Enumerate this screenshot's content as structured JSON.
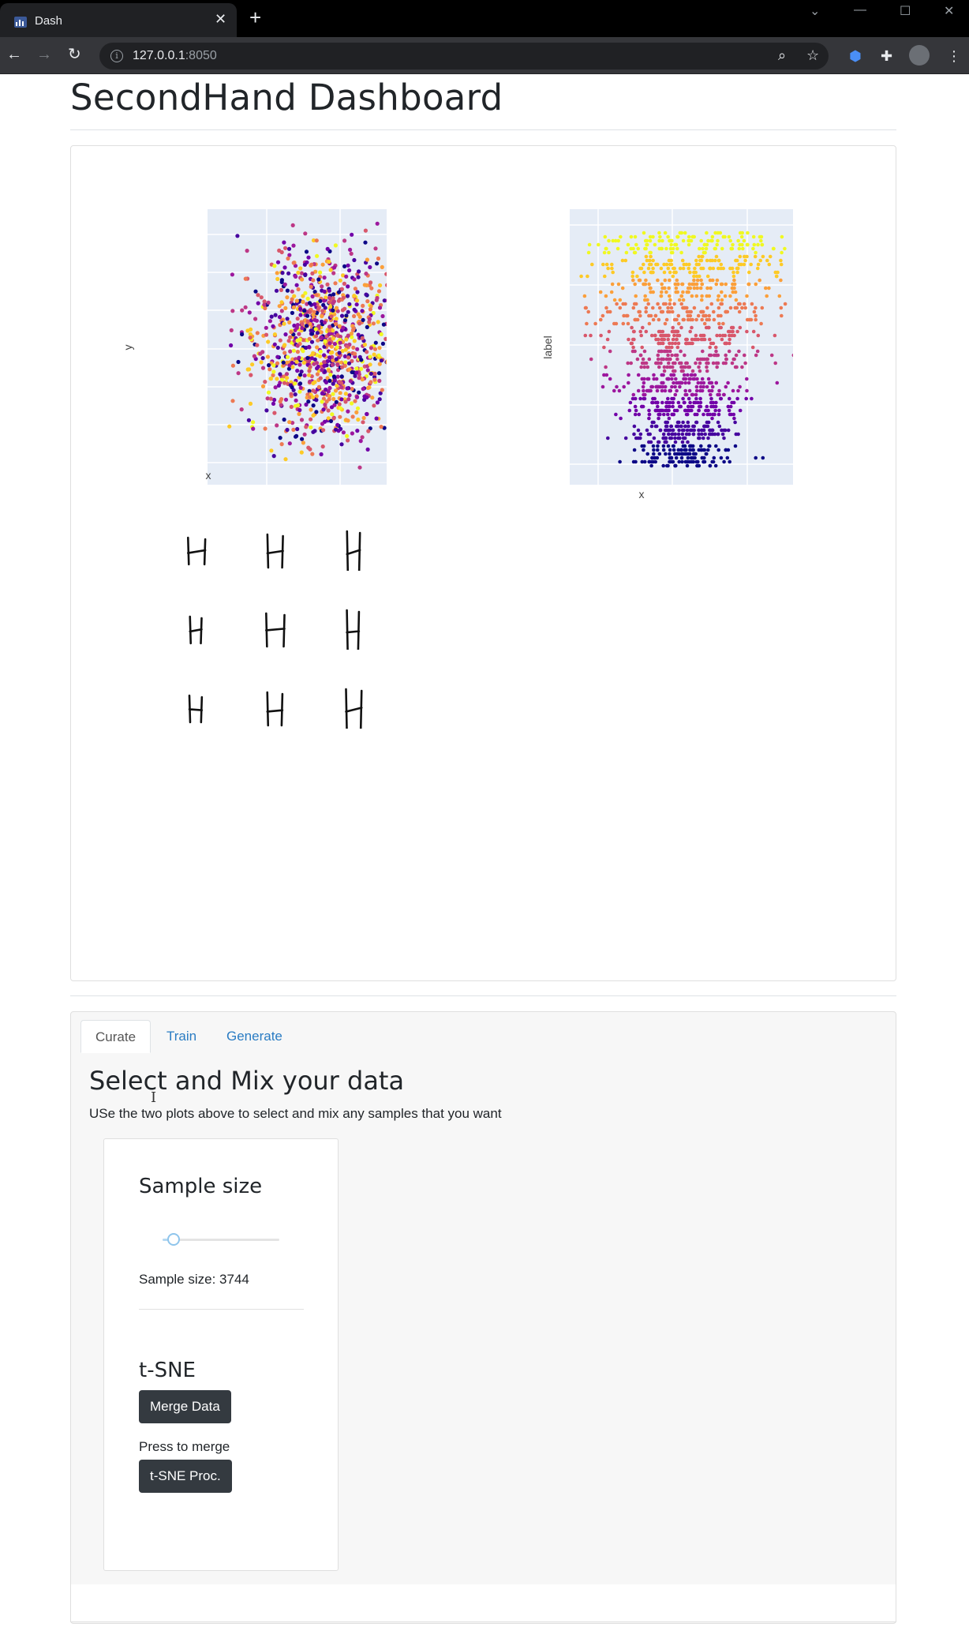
{
  "browser": {
    "tab_title": "Dash",
    "url_host": "127.0.0.1",
    "url_port": ":8050"
  },
  "page": {
    "title": "SecondHand Dashboard"
  },
  "plots": [
    {
      "xlabel": "x",
      "ylabel": "y"
    },
    {
      "xlabel": "x",
      "ylabel": "label"
    }
  ],
  "colors": {
    "plot_bg": "#e5ecf6",
    "palette": [
      "#0d0887",
      "#46039f",
      "#7201a8",
      "#9c179e",
      "#bd3786",
      "#d8576b",
      "#ed7953",
      "#fb9f3a",
      "#fdca26",
      "#f0f921"
    ],
    "button_dark": "#343a40",
    "tab_link": "#2a7cc3"
  },
  "tabs": [
    {
      "label": "Curate",
      "active": true
    },
    {
      "label": "Train",
      "active": false
    },
    {
      "label": "Generate",
      "active": false
    }
  ],
  "curate": {
    "heading": "Select and Mix your data",
    "subtitle": "USe the two plots above to select and mix any samples that you want",
    "sample_size_heading": "Sample size",
    "slider_value": 3744,
    "sample_size_text": "Sample size: 3744",
    "tsne_heading": "t-SNE",
    "merge_button": "Merge Data",
    "press_text": "Press to merge",
    "tsne_button": "t-SNE Proc."
  }
}
